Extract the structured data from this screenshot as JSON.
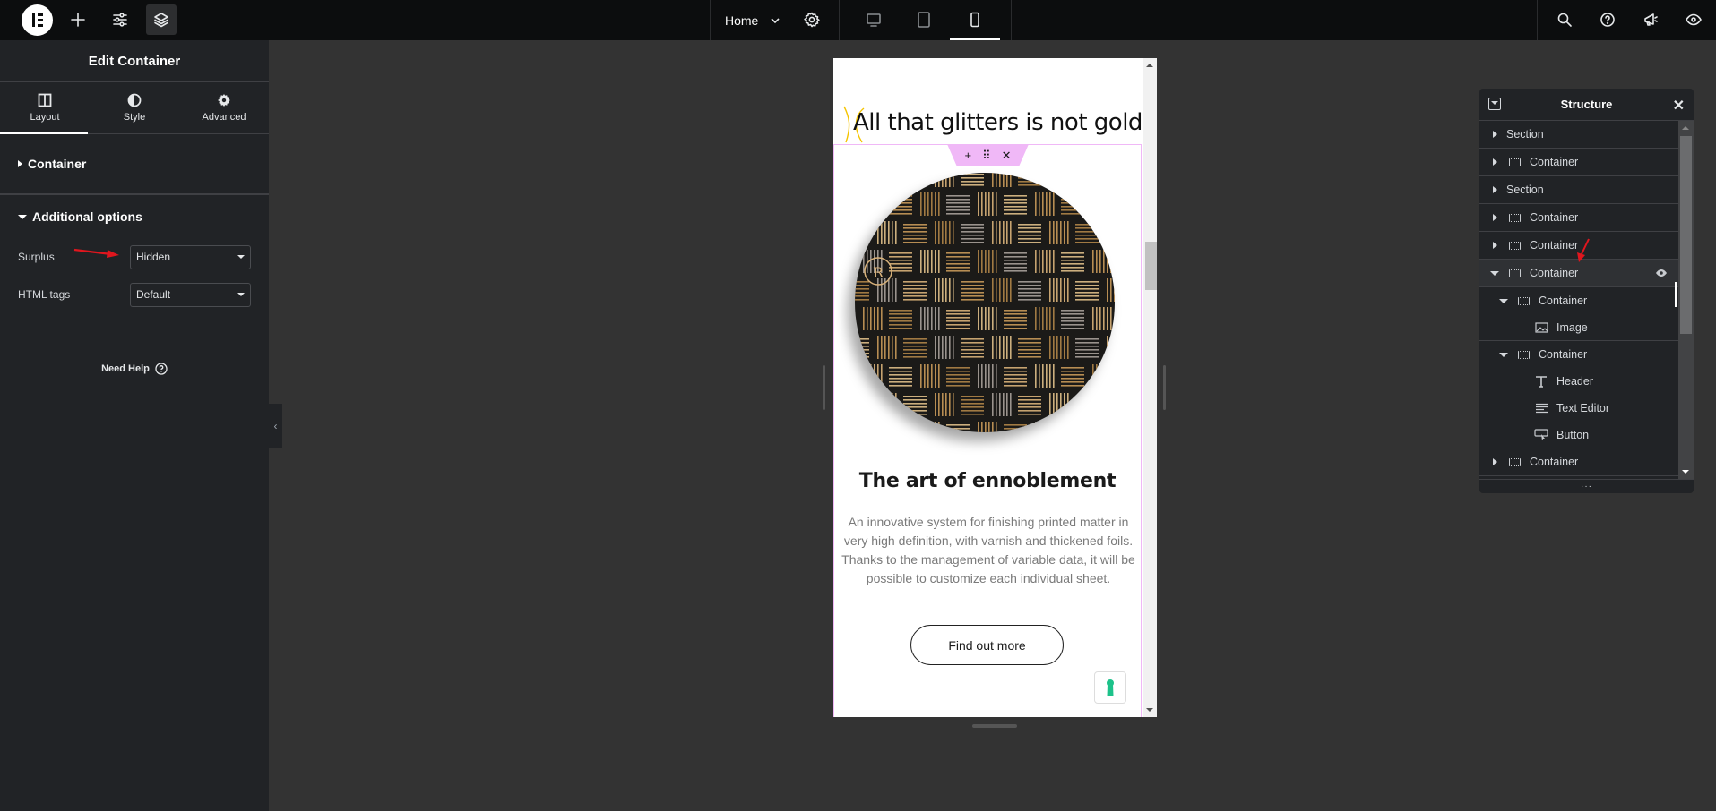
{
  "topbar": {
    "logo": "elementor-logo",
    "left_buttons": [
      {
        "name": "add-element-button",
        "icon": "plus-icon"
      },
      {
        "name": "site-settings-button",
        "icon": "sliders-icon"
      },
      {
        "name": "structure-button",
        "icon": "layers-icon",
        "active": true
      }
    ],
    "page_name": "Home",
    "page_settings_icon": "gear-icon",
    "devices": [
      {
        "name": "desktop",
        "icon": "desktop-icon",
        "active": false
      },
      {
        "name": "tablet",
        "icon": "tablet-icon",
        "active": false
      },
      {
        "name": "mobile",
        "icon": "mobile-icon",
        "active": true
      }
    ],
    "right_buttons": [
      {
        "name": "search-button",
        "icon": "search-icon"
      },
      {
        "name": "help-button",
        "icon": "help-icon"
      },
      {
        "name": "whats-new-button",
        "icon": "megaphone-icon"
      },
      {
        "name": "preview-button",
        "icon": "eye-icon"
      }
    ]
  },
  "left_panel": {
    "title": "Edit Container",
    "tabs": [
      {
        "label": "Layout",
        "icon": "columns-icon",
        "active": true
      },
      {
        "label": "Style",
        "icon": "half-circle-icon",
        "active": false
      },
      {
        "label": "Advanced",
        "icon": "gear-icon",
        "active": false
      }
    ],
    "sections": [
      {
        "label": "Container",
        "expanded": false
      },
      {
        "label": "Additional options",
        "expanded": true
      }
    ],
    "fields": [
      {
        "label": "Surplus",
        "value": "Hidden"
      },
      {
        "label": "HTML tags",
        "value": "Default"
      }
    ],
    "need_help": "Need Help"
  },
  "preview": {
    "heading": "All that glitters is not gold!",
    "handle_actions": [
      "+",
      "⠿",
      "✕"
    ],
    "art_heading": "The art of ennoblement",
    "art_text_1": "An innovative system for finishing printed matter in very high definition, with varnish and thickened foils.",
    "art_text_2": "Thanks to the management of variable data, it will be possible to customize each individual sheet.",
    "button_label": "Find out more",
    "image_alt": "Gold woven pattern coaster",
    "accent_color": "#f0b8f7"
  },
  "structure": {
    "title": "Structure",
    "items": [
      {
        "label": "Section",
        "level": 0,
        "caret": "right",
        "icon": ""
      },
      {
        "label": "Container",
        "level": 0,
        "caret": "right",
        "icon": "container-icon"
      },
      {
        "label": "Section",
        "level": 0,
        "caret": "right",
        "icon": ""
      },
      {
        "label": "Container",
        "level": 0,
        "caret": "right",
        "icon": "container-icon"
      },
      {
        "label": "Container",
        "level": 0,
        "caret": "right",
        "icon": "container-icon"
      },
      {
        "label": "Container",
        "level": 0,
        "caret": "down",
        "icon": "container-icon",
        "selected": true
      },
      {
        "label": "Container",
        "level": 1,
        "caret": "down",
        "icon": "container-icon"
      },
      {
        "label": "Image",
        "level": 2,
        "caret": "",
        "icon": "image-icon"
      },
      {
        "label": "Container",
        "level": 1,
        "caret": "down",
        "icon": "container-icon"
      },
      {
        "label": "Header",
        "level": 2,
        "caret": "",
        "icon": "heading-icon"
      },
      {
        "label": "Text Editor",
        "level": 2,
        "caret": "",
        "icon": "text-editor-icon"
      },
      {
        "label": "Button",
        "level": 2,
        "caret": "",
        "icon": "button-icon"
      },
      {
        "label": "Container",
        "level": 0,
        "caret": "right",
        "icon": "container-icon"
      }
    ],
    "footer": "···"
  }
}
